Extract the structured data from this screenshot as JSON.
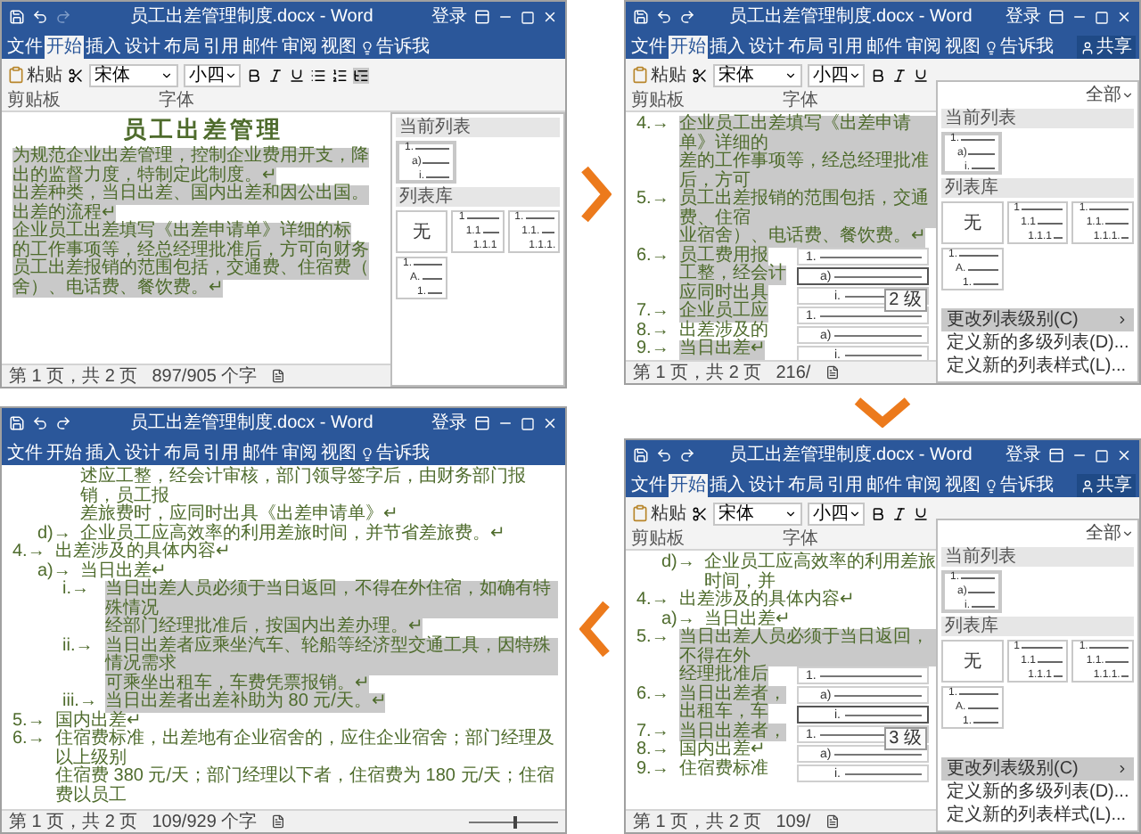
{
  "panels": [
    {
      "title": "员工出差管理制度.docx - Word",
      "login": "登录",
      "redo_disabled": true,
      "tabs": [
        {
          "label": "文件",
          "selected": false
        },
        {
          "label": "开始",
          "selected": true
        },
        {
          "label": "插入",
          "selected": false
        },
        {
          "label": "设计",
          "selected": false
        },
        {
          "label": "布局",
          "selected": false
        },
        {
          "label": "引用",
          "selected": false
        },
        {
          "label": "邮件",
          "selected": false
        },
        {
          "label": "审阅",
          "selected": false
        },
        {
          "label": "视图",
          "selected": false
        }
      ],
      "tell_me": "告诉我",
      "ribbon": {
        "paste": "粘贴",
        "font": "宋体",
        "size": "小四",
        "group_labels": [
          "剪贴板",
          "字体"
        ]
      },
      "document": {
        "heading": "员工出差管理",
        "items": [
          {
            "lines": [
              "为规范企业出差管理，控制企业费用开支，降",
              "出的监督力度，特制定此制度。↵"
            ],
            "highlighted": true
          },
          {
            "lines": [
              "出差种类，当日出差、国内出差和因公出国。"
            ],
            "highlighted": true
          },
          {
            "lines": [
              "出差的流程↵"
            ],
            "highlighted": true
          },
          {
            "lines": [
              "企业员工出差填写《出差申请单》详细的标",
              "的工作事项等，经总经理批准后，方可向财务"
            ],
            "highlighted": true
          },
          {
            "lines": [
              "员工出差报销的范围包括，交通费、住宿费（",
              "舍）、电话费、餐饮费。↵"
            ],
            "highlighted": true
          }
        ]
      },
      "list_menu": {
        "current_label": "当前列表",
        "current": [
          "1.",
          "a)",
          "i."
        ],
        "library_label": "列表库",
        "library": [
          {
            "kind": "none",
            "label": "无"
          },
          {
            "kind": "list",
            "markers": [
              "1",
              "1.1",
              "1.1.1"
            ]
          },
          {
            "kind": "list",
            "markers": [
              "1.",
              "1.1.",
              "1.1.1."
            ]
          },
          {
            "kind": "list",
            "markers": [
              "1.",
              "A.",
              "1."
            ]
          }
        ]
      },
      "status": {
        "page": "第 1 页，共 2 页",
        "words": "897/905 个字"
      }
    },
    {
      "title": "员工出差管理制度.docx - Word",
      "login": "登录",
      "redo_disabled": false,
      "tabs": [
        {
          "label": "文件",
          "selected": false
        },
        {
          "label": "开始",
          "selected": true
        },
        {
          "label": "插入",
          "selected": false
        },
        {
          "label": "设计",
          "selected": false
        },
        {
          "label": "布局",
          "selected": false
        },
        {
          "label": "引用",
          "selected": false
        },
        {
          "label": "邮件",
          "selected": false
        },
        {
          "label": "审阅",
          "selected": false
        },
        {
          "label": "视图",
          "selected": false
        }
      ],
      "tell_me": "告诉我",
      "share": "共享",
      "ribbon": {
        "paste": "粘贴",
        "font": "宋体",
        "size": "小四",
        "group_labels": [
          "剪贴板",
          "字体"
        ]
      },
      "document": {
        "items": [
          {
            "marker": "4.→",
            "lines": [
              "企业员工出差填写《出差申请单》详细的",
              "差的工作事项等，经总经理批准后，方可"
            ],
            "highlighted": true
          },
          {
            "marker": "5.→",
            "lines": [
              "员工出差报销的范围包括，交通费、住宿",
              "业宿舍）、电话费、餐饮费。↵"
            ],
            "highlighted": true
          },
          {
            "marker": "6.→",
            "lines": [
              "员工费用报",
              "工整，经会计",
              "应同时出具"
            ],
            "highlighted": true
          },
          {
            "marker": "7.→",
            "lines": [
              "企业员工应"
            ],
            "highlighted": true
          },
          {
            "marker": "8.→",
            "lines": [
              "出差涉及的"
            ],
            "highlighted": false
          },
          {
            "marker": "9.→",
            "lines": [
              "当日出差↵"
            ],
            "highlighted": true
          }
        ]
      },
      "level_menu": {
        "items": [
          {
            "marker": "1.",
            "selected": false
          },
          {
            "marker": "a)",
            "selected": true
          },
          {
            "marker": "i.",
            "selected": false
          },
          {
            "marker": "1.",
            "selected": false
          },
          {
            "marker": "a)",
            "selected": false
          },
          {
            "marker": "i.",
            "selected": false
          }
        ],
        "tooltip": "2 级"
      },
      "list_menu": {
        "filter": "全部",
        "current_label": "当前列表",
        "current": [
          "1.",
          "a)",
          "i."
        ],
        "library_label": "列表库",
        "library": [
          {
            "kind": "none",
            "label": "无"
          },
          {
            "kind": "list",
            "markers": [
              "1",
              "1.1",
              "1.1.1"
            ]
          },
          {
            "kind": "list",
            "markers": [
              "1.",
              "1.1.",
              "1.1.1."
            ]
          },
          {
            "kind": "list",
            "markers": [
              "1.",
              "A.",
              "1."
            ]
          }
        ],
        "commands": [
          {
            "label": "更改列表级别(C)",
            "selected": true,
            "has_submenu": true
          },
          {
            "label": "定义新的多级列表(D)...",
            "selected": false,
            "has_submenu": false
          },
          {
            "label": "定义新的列表样式(L)...",
            "selected": false,
            "has_submenu": false
          }
        ]
      },
      "status": {
        "page": "第 1 页，共 2 页",
        "words": "216/"
      }
    },
    {
      "title": "员工出差管理制度.docx - Word",
      "login": "登录",
      "redo_disabled": false,
      "tabs": [
        {
          "label": "文件",
          "selected": false
        },
        {
          "label": "开始",
          "selected": true
        },
        {
          "label": "插入",
          "selected": false
        },
        {
          "label": "设计",
          "selected": false
        },
        {
          "label": "布局",
          "selected": false
        },
        {
          "label": "引用",
          "selected": false
        },
        {
          "label": "邮件",
          "selected": false
        },
        {
          "label": "审阅",
          "selected": false
        },
        {
          "label": "视图",
          "selected": false
        }
      ],
      "tell_me": "告诉我",
      "share": "共享",
      "ribbon": {
        "paste": "粘贴",
        "font": "宋体",
        "size": "小四",
        "group_labels": [
          "剪贴板",
          "字体"
        ]
      },
      "document": {
        "items": [
          {
            "children": [
              {
                "marker": "d)→",
                "lines": [
                  "企业员工应高效率的利用差旅时间，并"
                ],
                "highlighted": false
              }
            ]
          },
          {
            "marker": "4.→",
            "lines": [
              "出差涉及的具体内容↵"
            ],
            "highlighted": false,
            "children": [
              {
                "marker": "a)→",
                "lines": [
                  "当日出差↵"
                ],
                "highlighted": false
              }
            ]
          },
          {
            "marker": "5.→",
            "lines": [
              "当日出差人员必须于当日返回，不得在外",
              "经理批准后"
            ],
            "highlighted": true
          },
          {
            "marker": "6.→",
            "lines": [
              "当日出差者，",
              "出租车，车"
            ],
            "highlighted": true
          },
          {
            "marker": "7.→",
            "lines": [
              "当日出差者，"
            ],
            "highlighted": true
          },
          {
            "marker": "8.→",
            "lines": [
              "国内出差↵"
            ],
            "highlighted": false
          },
          {
            "marker": "9.→",
            "lines": [
              "住宿费标准"
            ],
            "highlighted": false
          }
        ]
      },
      "level_menu": {
        "items": [
          {
            "marker": "1.",
            "selected": false
          },
          {
            "marker": "a)",
            "selected": false
          },
          {
            "marker": "i.",
            "selected": true
          },
          {
            "marker": "1.",
            "selected": false
          },
          {
            "marker": "a)",
            "selected": false
          },
          {
            "marker": "i.",
            "selected": false
          }
        ],
        "tooltip": "3 级"
      },
      "list_menu": {
        "filter": "全部",
        "current_label": "当前列表",
        "current": [
          "1.",
          "a)",
          "i."
        ],
        "library_label": "列表库",
        "library": [
          {
            "kind": "none",
            "label": "无"
          },
          {
            "kind": "list",
            "markers": [
              "1",
              "1.1",
              "1.1.1"
            ]
          },
          {
            "kind": "list",
            "markers": [
              "1.",
              "1.1.",
              "1.1.1."
            ]
          },
          {
            "kind": "list",
            "markers": [
              "1.",
              "A.",
              "1."
            ]
          }
        ],
        "commands": [
          {
            "label": "更改列表级别(C)",
            "selected": true,
            "has_submenu": true
          },
          {
            "label": "定义新的多级列表(D)...",
            "selected": false,
            "has_submenu": false
          },
          {
            "label": "定义新的列表样式(L)...",
            "selected": false,
            "has_submenu": false
          }
        ]
      },
      "status": {
        "page": "第 1 页，共 2 页",
        "words": "109/"
      }
    },
    {
      "title": "员工出差管理制度.docx - Word",
      "login": "登录",
      "redo_disabled": false,
      "tabs": [
        {
          "label": "文件",
          "selected": false
        },
        {
          "label": "开始",
          "selected": false
        },
        {
          "label": "插入",
          "selected": false
        },
        {
          "label": "设计",
          "selected": false
        },
        {
          "label": "布局",
          "selected": false
        },
        {
          "label": "引用",
          "selected": false
        },
        {
          "label": "邮件",
          "selected": false
        },
        {
          "label": "审阅",
          "selected": false
        },
        {
          "label": "视图",
          "selected": false
        }
      ],
      "tell_me": "告诉我",
      "document": {
        "items": [
          {
            "children": [
              {
                "lines": [
                  "述应工整，经会计审核，部门领导签字后，由财务部门报销，员工报",
                  "差旅费时，应同时出具《出差申请单》↵"
                ],
                "highlighted": false
              },
              {
                "marker": "d)→",
                "lines": [
                  "企业员工应高效率的利用差旅时间，并节省差旅费。↵"
                ],
                "highlighted": false
              }
            ]
          },
          {
            "marker": "4.→",
            "lines": [
              "出差涉及的具体内容↵"
            ],
            "highlighted": false,
            "children": [
              {
                "marker": "a)→",
                "lines": [
                  "当日出差↵"
                ],
                "highlighted": false,
                "children": [
                  {
                    "marker": "i.→",
                    "lines": [
                      "当日出差人员必须于当日返回，不得在外住宿，如确有特殊情况",
                      "经部门经理批准后，按国内出差办理。↵"
                    ],
                    "highlighted": true
                  },
                  {
                    "marker": "ii.→",
                    "lines": [
                      "当日出差者应乘坐汽车、轮船等经济型交通工具，因特殊情况需求",
                      "可乘坐出租车，车费凭票报销。↵"
                    ],
                    "highlighted": true
                  },
                  {
                    "marker": "iii.→",
                    "lines": [
                      "当日出差者出差补助为 80 元/天。↵"
                    ],
                    "highlighted": true
                  }
                ]
              }
            ]
          },
          {
            "marker": "5.→",
            "lines": [
              "国内出差↵"
            ],
            "highlighted": false
          },
          {
            "marker": "6.→",
            "lines": [
              "住宿费标准，出差地有企业宿舍的，应住企业宿舍；部门经理及以上级别",
              "住宿费 380 元/天；部门经理以下者，住宿费为 180 元/天；住宿费以员工"
            ],
            "highlighted": false
          }
        ]
      },
      "status": {
        "page": "第 1 页，共 2 页",
        "words": "109/929 个字",
        "zoom": {
          "level": 0.5
        }
      }
    }
  ]
}
